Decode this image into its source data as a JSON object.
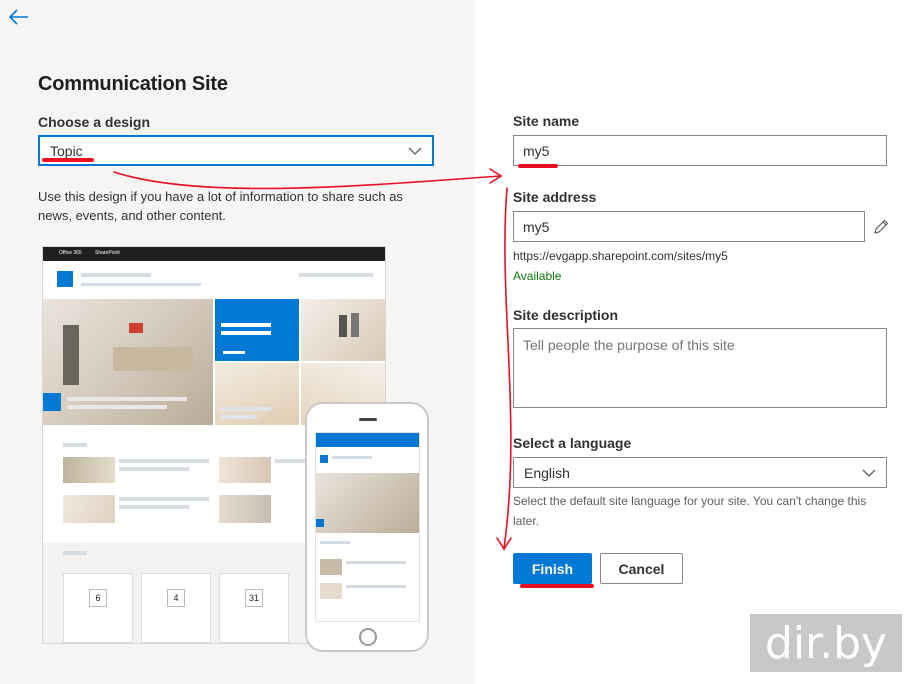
{
  "left": {
    "title": "Communication Site",
    "design_label": "Choose a design",
    "design_value": "Topic",
    "design_description": "Use this design if you have a lot of information to share such as news, events, and other content."
  },
  "right": {
    "site_name_label": "Site name",
    "site_name_value": "my5",
    "site_address_label": "Site address",
    "site_address_value": "my5",
    "site_url": "https://evgapp.sharepoint.com/sites/my5",
    "availability": "Available",
    "site_description_label": "Site description",
    "site_description_placeholder": "Tell people the purpose of this site",
    "language_label": "Select a language",
    "language_value": "English",
    "language_help": "Select the default site language for your site. You can't change this later.",
    "finish_label": "Finish",
    "cancel_label": "Cancel"
  },
  "preview": {
    "office_label": "Office 365",
    "sharepoint_label": "SharePoint",
    "event_dates": [
      "6",
      "4",
      "31"
    ]
  },
  "watermark": "dir.by",
  "colors": {
    "accent": "#0078d4",
    "annotation": "#e81123",
    "available": "#107c10"
  }
}
